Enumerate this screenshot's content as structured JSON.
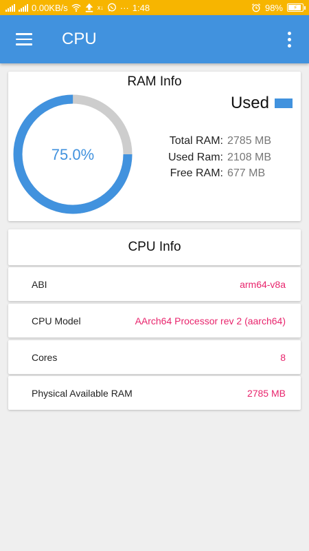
{
  "status_bar": {
    "network_speed": "0.00KB/s",
    "time": "1:48",
    "battery": "98%",
    "icons": [
      "signal-icon",
      "wifi-icon",
      "upload-icon",
      "whatsapp-icon",
      "more-notifications-icon",
      "alarm-icon",
      "battery-icon"
    ]
  },
  "app_bar": {
    "title": "CPU",
    "menu_icon": "hamburger-menu-icon",
    "more_icon": "more-vert-icon",
    "color": "#4192de"
  },
  "ram_info": {
    "title": "RAM Info",
    "legend": "Used",
    "percent_label": "75.0%",
    "used_fraction": 0.75,
    "used_color": "#4192de",
    "free_color": "#cdcdcd",
    "total_label": "Total RAM:",
    "total_value": "2785 MB",
    "used_label": "Used Ram:",
    "used_value": "2108 MB",
    "free_label": "Free RAM:",
    "free_value": "677 MB"
  },
  "cpu_info": {
    "title": "CPU Info",
    "rows": [
      {
        "label": "ABI",
        "value": "arm64-v8a"
      },
      {
        "label": "CPU Model",
        "value": "AArch64 Processor rev 2 (aarch64)"
      },
      {
        "label": "Cores",
        "value": "8"
      },
      {
        "label": "Physical Available RAM",
        "value": "2785 MB"
      }
    ],
    "value_color": "#e8246c"
  }
}
